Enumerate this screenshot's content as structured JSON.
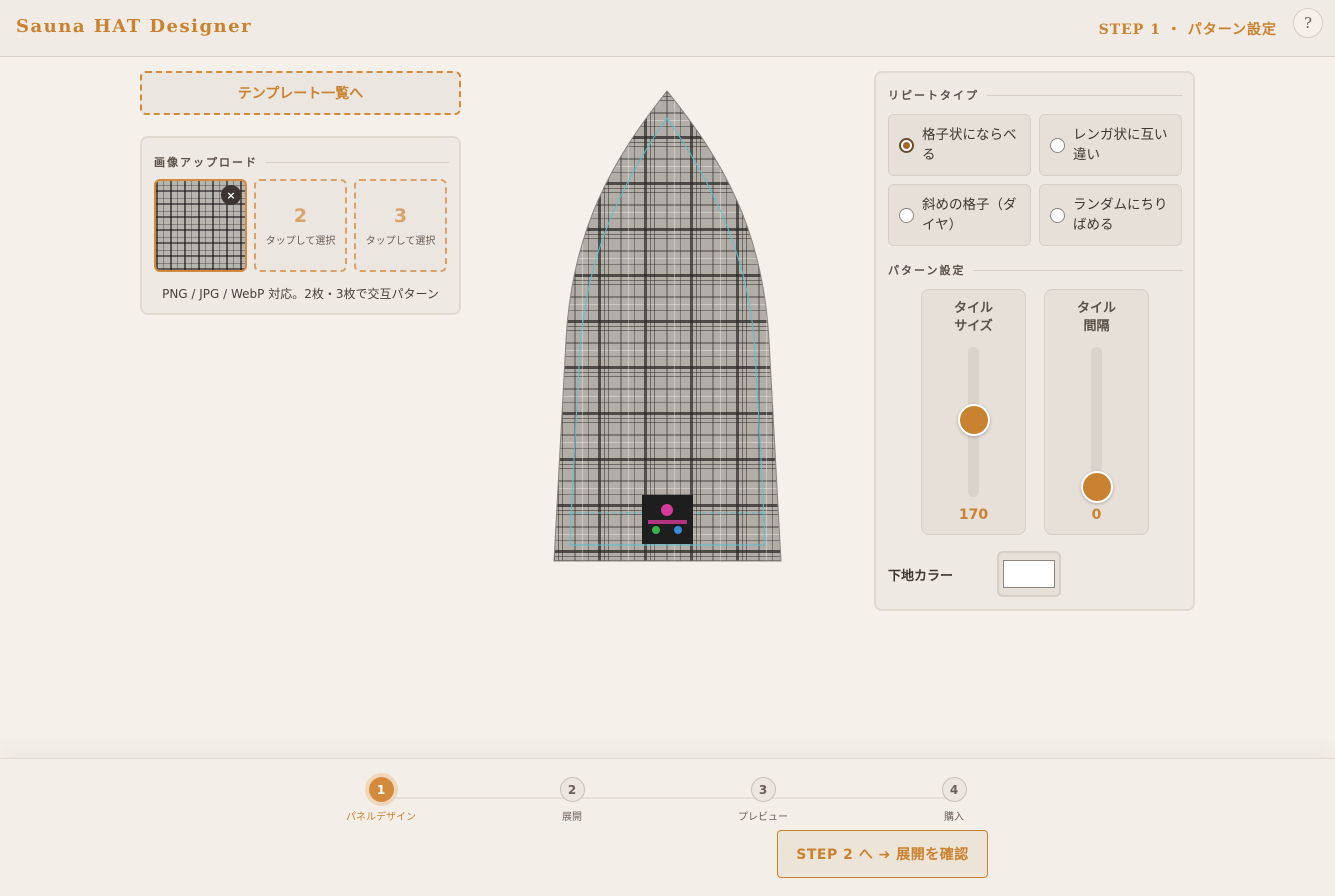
{
  "header": {
    "app_title": "Sauna HAT Designer",
    "step_label": "STEP 1 ・ パターン設定",
    "help_label": "?"
  },
  "left": {
    "template_button": "テンプレート一覧へ",
    "upload": {
      "title": "画像アップロード",
      "remove_label": "×",
      "slots": [
        {
          "number": "2",
          "hint": "タップして選択"
        },
        {
          "number": "3",
          "hint": "タップして選択"
        }
      ],
      "note": "PNG / JPG / WebP 対応。2枚・3枚で交互パターン"
    }
  },
  "right": {
    "repeat_title": "リピートタイプ",
    "repeat_options": [
      {
        "label": "格子状にならべる",
        "checked": true
      },
      {
        "label": "レンガ状に互い違い",
        "checked": false
      },
      {
        "label": "斜めの格子（ダイヤ）",
        "checked": false
      },
      {
        "label": "ランダムにちりばめる",
        "checked": false
      }
    ],
    "pattern_title": "パターン設定",
    "sliders": [
      {
        "label_line1": "タイル",
        "label_line2": "サイズ",
        "value": "170",
        "level": 0.5
      },
      {
        "label_line1": "タイル",
        "label_line2": "間隔",
        "value": "0",
        "level": 0.0
      }
    ],
    "base_color_label": "下地カラー",
    "base_color": "#ffffff"
  },
  "footer": {
    "steps": [
      {
        "number": "1",
        "name": "パネルデザイン",
        "active": true
      },
      {
        "number": "2",
        "name": "展開",
        "active": false
      },
      {
        "number": "3",
        "name": "プレビュー",
        "active": false
      },
      {
        "number": "4",
        "name": "購入",
        "active": false
      }
    ],
    "next_button": "STEP 2 へ ➔ 展開を確認"
  },
  "colors": {
    "accent": "#c9822f",
    "background": "#f5f1ea",
    "guide_line": "#5bbfd0"
  },
  "icons": {
    "help": "question-icon",
    "remove": "close-icon"
  }
}
